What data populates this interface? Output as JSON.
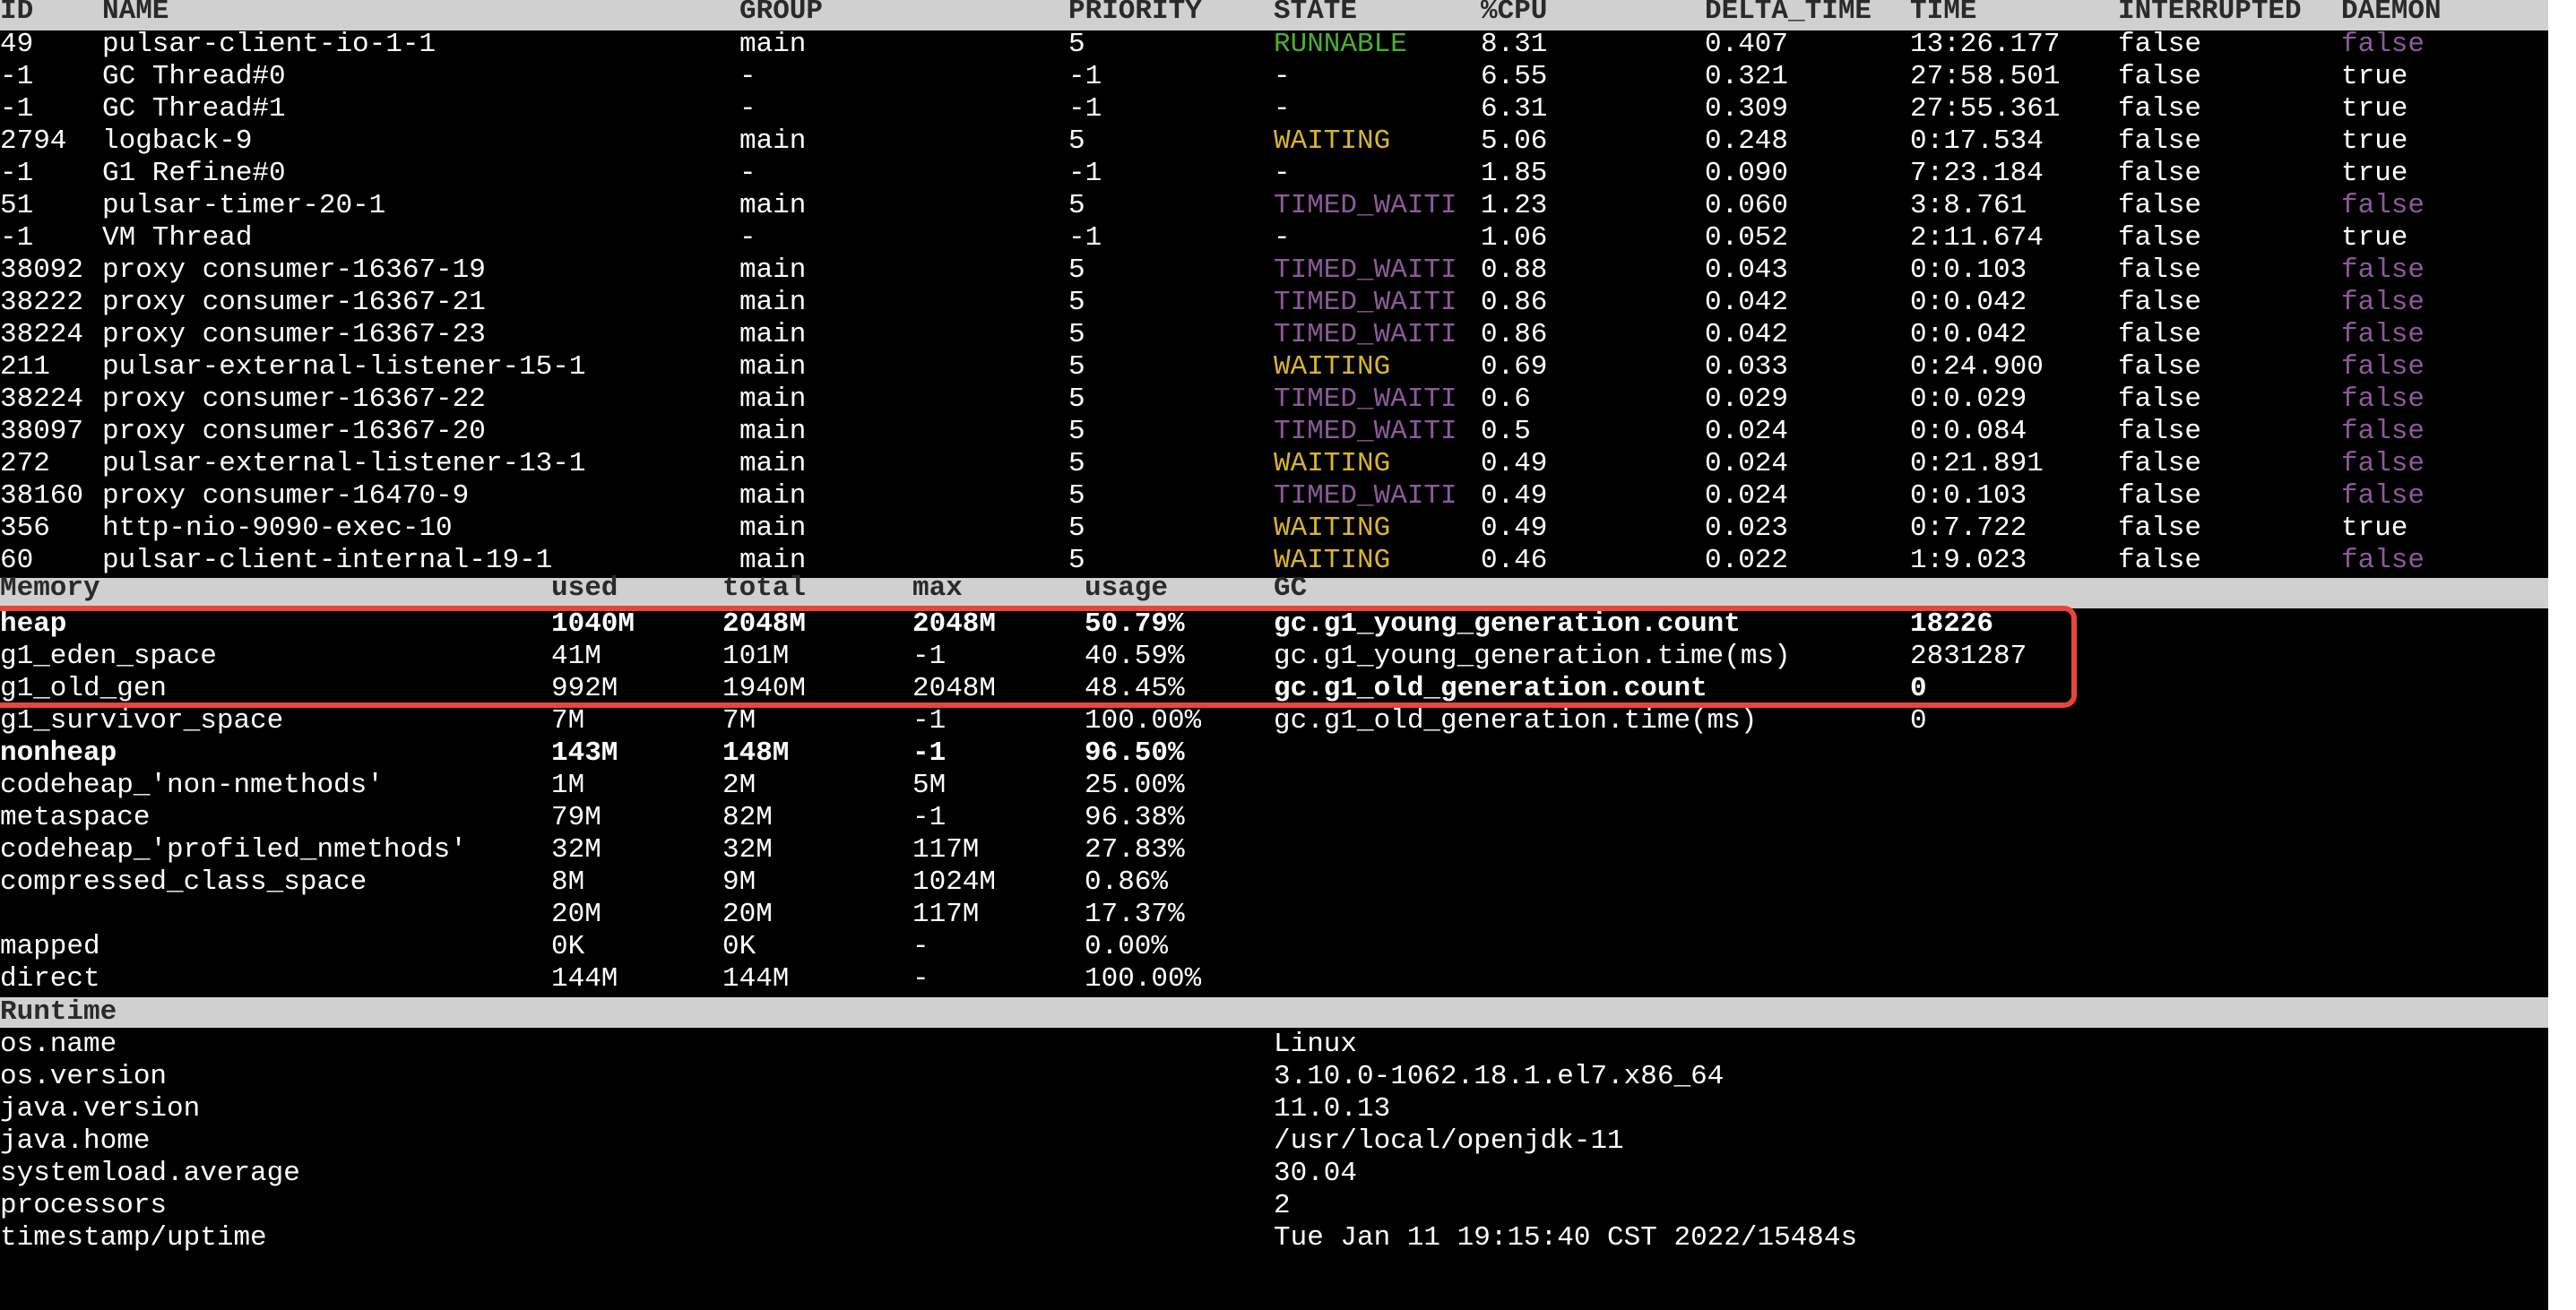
{
  "threads": {
    "headers": {
      "id": "ID",
      "name": "NAME",
      "group": "GROUP",
      "priority": "PRIORITY",
      "state": "STATE",
      "cpu": "%CPU",
      "delta_time": "DELTA_TIME",
      "time": "TIME",
      "interrupted": "INTERRUPTED",
      "daemon": "DAEMON"
    },
    "rows": [
      {
        "id": "49",
        "name": "pulsar-client-io-1-1",
        "group": "main",
        "priority": "5",
        "state": "RUNNABLE",
        "cpu": "8.31",
        "delta_time": "0.407",
        "time": "13:26.177",
        "interrupted": "false",
        "daemon": "false"
      },
      {
        "id": "-1",
        "name": "GC Thread#0",
        "group": "-",
        "priority": "-1",
        "state": "-",
        "cpu": "6.55",
        "delta_time": "0.321",
        "time": "27:58.501",
        "interrupted": "false",
        "daemon": "true"
      },
      {
        "id": "-1",
        "name": "GC Thread#1",
        "group": "-",
        "priority": "-1",
        "state": "-",
        "cpu": "6.31",
        "delta_time": "0.309",
        "time": "27:55.361",
        "interrupted": "false",
        "daemon": "true"
      },
      {
        "id": "2794",
        "name": "logback-9",
        "group": "main",
        "priority": "5",
        "state": "WAITING",
        "cpu": "5.06",
        "delta_time": "0.248",
        "time": "0:17.534",
        "interrupted": "false",
        "daemon": "true"
      },
      {
        "id": "-1",
        "name": "G1 Refine#0",
        "group": "-",
        "priority": "-1",
        "state": "-",
        "cpu": "1.85",
        "delta_time": "0.090",
        "time": "7:23.184",
        "interrupted": "false",
        "daemon": "true"
      },
      {
        "id": "51",
        "name": "pulsar-timer-20-1",
        "group": "main",
        "priority": "5",
        "state": "TIMED_WAITI",
        "cpu": "1.23",
        "delta_time": "0.060",
        "time": "3:8.761",
        "interrupted": "false",
        "daemon": "false"
      },
      {
        "id": "-1",
        "name": "VM Thread",
        "group": "-",
        "priority": "-1",
        "state": "-",
        "cpu": "1.06",
        "delta_time": "0.052",
        "time": "2:11.674",
        "interrupted": "false",
        "daemon": "true"
      },
      {
        "id": "38092",
        "name": "proxy consumer-16367-19",
        "group": "main",
        "priority": "5",
        "state": "TIMED_WAITI",
        "cpu": "0.88",
        "delta_time": "0.043",
        "time": "0:0.103",
        "interrupted": "false",
        "daemon": "false"
      },
      {
        "id": "38222",
        "name": "proxy consumer-16367-21",
        "group": "main",
        "priority": "5",
        "state": "TIMED_WAITI",
        "cpu": "0.86",
        "delta_time": "0.042",
        "time": "0:0.042",
        "interrupted": "false",
        "daemon": "false"
      },
      {
        "id": "38224",
        "name": "proxy consumer-16367-23",
        "group": "main",
        "priority": "5",
        "state": "TIMED_WAITI",
        "cpu": "0.86",
        "delta_time": "0.042",
        "time": "0:0.042",
        "interrupted": "false",
        "daemon": "false"
      },
      {
        "id": "211",
        "name": "pulsar-external-listener-15-1",
        "group": "main",
        "priority": "5",
        "state": "WAITING",
        "cpu": "0.69",
        "delta_time": "0.033",
        "time": "0:24.900",
        "interrupted": "false",
        "daemon": "false"
      },
      {
        "id": "38224",
        "name": "proxy consumer-16367-22",
        "group": "main",
        "priority": "5",
        "state": "TIMED_WAITI",
        "cpu": "0.6",
        "delta_time": "0.029",
        "time": "0:0.029",
        "interrupted": "false",
        "daemon": "false"
      },
      {
        "id": "38097",
        "name": "proxy consumer-16367-20",
        "group": "main",
        "priority": "5",
        "state": "TIMED_WAITI",
        "cpu": "0.5",
        "delta_time": "0.024",
        "time": "0:0.084",
        "interrupted": "false",
        "daemon": "false"
      },
      {
        "id": "272",
        "name": "pulsar-external-listener-13-1",
        "group": "main",
        "priority": "5",
        "state": "WAITING",
        "cpu": "0.49",
        "delta_time": "0.024",
        "time": "0:21.891",
        "interrupted": "false",
        "daemon": "false"
      },
      {
        "id": "38160",
        "name": "proxy consumer-16470-9",
        "group": "main",
        "priority": "5",
        "state": "TIMED_WAITI",
        "cpu": "0.49",
        "delta_time": "0.024",
        "time": "0:0.103",
        "interrupted": "false",
        "daemon": "false"
      },
      {
        "id": "356",
        "name": "http-nio-9090-exec-10",
        "group": "main",
        "priority": "5",
        "state": "WAITING",
        "cpu": "0.49",
        "delta_time": "0.023",
        "time": "0:7.722",
        "interrupted": "false",
        "daemon": "true"
      },
      {
        "id": "60",
        "name": "pulsar-client-internal-19-1",
        "group": "main",
        "priority": "5",
        "state": "WAITING",
        "cpu": "0.46",
        "delta_time": "0.022",
        "time": "1:9.023",
        "interrupted": "false",
        "daemon": "false"
      }
    ]
  },
  "memory": {
    "headers": {
      "memory": "Memory",
      "used": "used",
      "total": "total",
      "max": "max",
      "usage": "usage",
      "gc": "GC"
    },
    "rows": [
      {
        "name": "heap",
        "used": "1040M",
        "total": "2048M",
        "max": "2048M",
        "usage": "50.79%",
        "bold": true
      },
      {
        "name": "g1_eden_space",
        "used": "41M",
        "total": "101M",
        "max": "-1",
        "usage": "40.59%",
        "bold": false
      },
      {
        "name": "g1_old_gen",
        "used": "992M",
        "total": "1940M",
        "max": "2048M",
        "usage": "48.45%",
        "bold": false
      },
      {
        "name": "g1_survivor_space",
        "used": "7M",
        "total": "7M",
        "max": "-1",
        "usage": "100.00%",
        "bold": false
      },
      {
        "name": "nonheap",
        "used": "143M",
        "total": "148M",
        "max": "-1",
        "usage": "96.50%",
        "bold": true
      },
      {
        "name": "codeheap_'non-nmethods'",
        "used": "1M",
        "total": "2M",
        "max": "5M",
        "usage": "25.00%",
        "bold": false
      },
      {
        "name": "metaspace",
        "used": "79M",
        "total": "82M",
        "max": "-1",
        "usage": "96.38%",
        "bold": false
      },
      {
        "name": "codeheap_'profiled_nmethods'",
        "used": "32M",
        "total": "32M",
        "max": "117M",
        "usage": "27.83%",
        "bold": false
      },
      {
        "name": "compressed_class_space",
        "used": "8M",
        "total": "9M",
        "max": "1024M",
        "usage": "0.86%",
        "bold": false
      },
      {
        "name": "",
        "used": "20M",
        "total": "20M",
        "max": "117M",
        "usage": "17.37%",
        "bold": false
      },
      {
        "name": "mapped",
        "used": "0K",
        "total": "0K",
        "max": "-",
        "usage": "0.00%",
        "bold": false
      },
      {
        "name": "direct",
        "used": "144M",
        "total": "144M",
        "max": "-",
        "usage": "100.00%",
        "bold": false
      }
    ],
    "gc_rows": [
      {
        "key": "gc.g1_young_generation.count",
        "value": "18226",
        "bold": true
      },
      {
        "key": "gc.g1_young_generation.time(ms)",
        "value": "2831287",
        "bold": false
      },
      {
        "key": "gc.g1_old_generation.count",
        "value": "0",
        "bold": true
      },
      {
        "key": "gc.g1_old_generation.time(ms)",
        "value": "0",
        "bold": false
      }
    ]
  },
  "runtime": {
    "header": "Runtime",
    "rows": [
      {
        "key": "os.name",
        "value": "Linux"
      },
      {
        "key": "os.version",
        "value": "3.10.0-1062.18.1.el7.x86_64"
      },
      {
        "key": "java.version",
        "value": "11.0.13"
      },
      {
        "key": "java.home",
        "value": "/usr/local/openjdk-11"
      },
      {
        "key": "systemload.average",
        "value": "30.04"
      },
      {
        "key": "processors",
        "value": "2"
      },
      {
        "key": "timestamp/uptime",
        "value": "Tue Jan 11 19:15:40 CST 2022/15484s"
      }
    ]
  },
  "colors": {
    "background": "#000000",
    "header_band": "#d0d0d0",
    "runnable": "#4caf2e",
    "waiting": "#d8b430",
    "timed_waiting": "#8c5a9a",
    "daemon_false": "#8c5a9a",
    "highlight_box": "#e8453c"
  }
}
